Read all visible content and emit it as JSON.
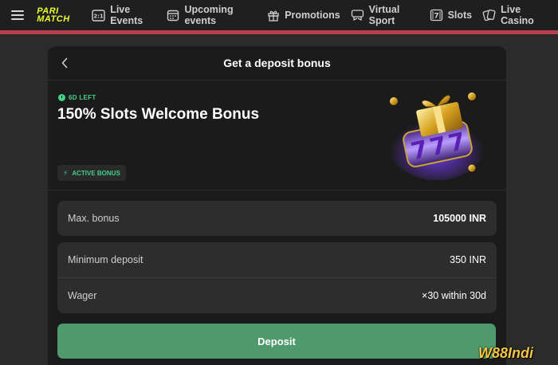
{
  "nav": {
    "logo_line1": "PARI",
    "logo_line2": "MATCH",
    "items": [
      {
        "label": "Live Events",
        "icon": "live-events-icon"
      },
      {
        "label": "Upcoming events",
        "icon": "calendar-icon"
      },
      {
        "label": "Promotions",
        "icon": "gift-icon"
      },
      {
        "label": "Virtual Sport",
        "icon": "gamepad-icon"
      },
      {
        "label": "Slots",
        "icon": "slots-icon"
      },
      {
        "label": "Live Casino",
        "icon": "cards-icon"
      }
    ]
  },
  "card": {
    "title": "Get a deposit bonus",
    "promo": {
      "time_left": "6D LEFT",
      "name": "150% Slots Welcome Bonus",
      "status": "ACTIVE BONUS"
    },
    "rows_top": [
      {
        "label": "Max. bonus",
        "value": "105000 INR"
      }
    ],
    "rows_bottom": [
      {
        "label": "Minimum deposit",
        "value": "350 INR"
      },
      {
        "label": "Wager",
        "value": "×30 within 30d"
      }
    ],
    "deposit_label": "Deposit"
  },
  "watermark": "W88Indi",
  "colors": {
    "accent_red": "#b8404e",
    "logo_yellow": "#e9ff2b",
    "green": "#43d18b",
    "deposit_button": "#4f9a6d"
  }
}
